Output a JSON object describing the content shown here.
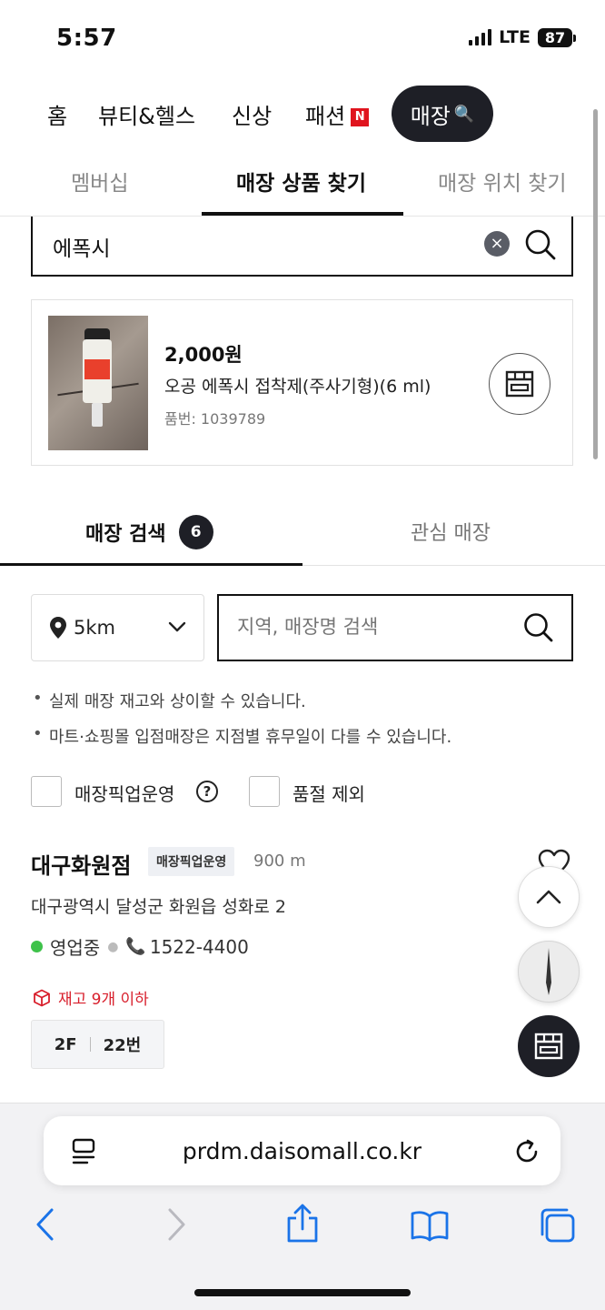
{
  "status_bar": {
    "time": "5:57",
    "network": "LTE",
    "battery": "87"
  },
  "top_nav": {
    "items": [
      {
        "label": "홈"
      },
      {
        "label": "뷰티&헬스"
      },
      {
        "label": "신상"
      },
      {
        "label": "패션",
        "badge": "N"
      }
    ],
    "active": {
      "label": "매장"
    }
  },
  "sub_tabs": {
    "items": [
      {
        "label": "멤버십"
      },
      {
        "label": "매장 상품 찾기"
      },
      {
        "label": "매장 위치 찾기"
      }
    ],
    "active_index": 1
  },
  "search": {
    "value": "에폭시"
  },
  "product": {
    "price": "2,000원",
    "name": "오공 에폭시 접착제(주사기형)(6 ml)",
    "code": "품번: 1039789"
  },
  "store_tabs": {
    "search_label": "매장 검색",
    "search_count": "6",
    "fav_label": "관심 매장"
  },
  "filters": {
    "distance": "5km",
    "region_placeholder": "지역, 매장명 검색",
    "notes": [
      "실제 매장 재고와 상이할 수 있습니다.",
      "마트·쇼핑몰 입점매장은 지점별 휴무일이 다를 수 있습니다."
    ],
    "pickup_label": "매장픽업운영",
    "soldout_label": "품절 제외"
  },
  "store": {
    "name": "대구화원점",
    "tag": "매장픽업운영",
    "distance": "900 m",
    "address": "대구광역시 달성군 화원읍 성화로 2",
    "status": "영업중",
    "phone": "1522-4400",
    "stock": "재고 9개 이하",
    "floor": "2F",
    "slot": "22번"
  },
  "browser": {
    "url": "prdm.daisomall.co.kr"
  },
  "colors": {
    "accent_dark": "#1e1f26",
    "new_badge": "#e0141e",
    "stock_red": "#d81e2b",
    "open_green": "#3ec24a",
    "ios_blue": "#1a73e8"
  }
}
